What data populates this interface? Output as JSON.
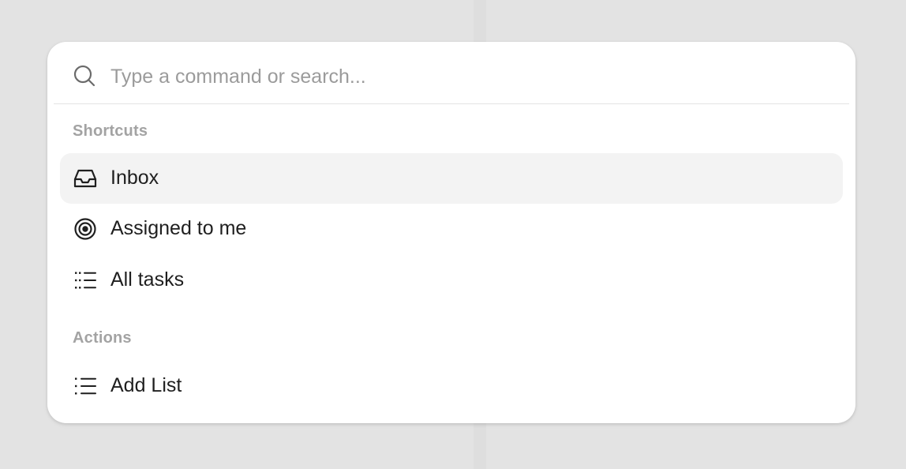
{
  "search": {
    "placeholder": "Type a command or search...",
    "value": "",
    "icon": "search-icon"
  },
  "groups": {
    "shortcuts": {
      "label": "Shortcuts",
      "items": [
        {
          "label": "Inbox",
          "icon": "inbox-icon",
          "active": true
        },
        {
          "label": "Assigned to me",
          "icon": "target-icon",
          "active": false
        },
        {
          "label": "All tasks",
          "icon": "dotted-list-icon",
          "active": false
        }
      ]
    },
    "actions": {
      "label": "Actions",
      "items": [
        {
          "label": "Add List",
          "icon": "list-icon",
          "active": false
        }
      ]
    }
  },
  "colors": {
    "background": "#e3e3e3",
    "panel": "#ffffff",
    "highlight": "#f3f3f3",
    "muted_text": "#a3a3a3"
  }
}
